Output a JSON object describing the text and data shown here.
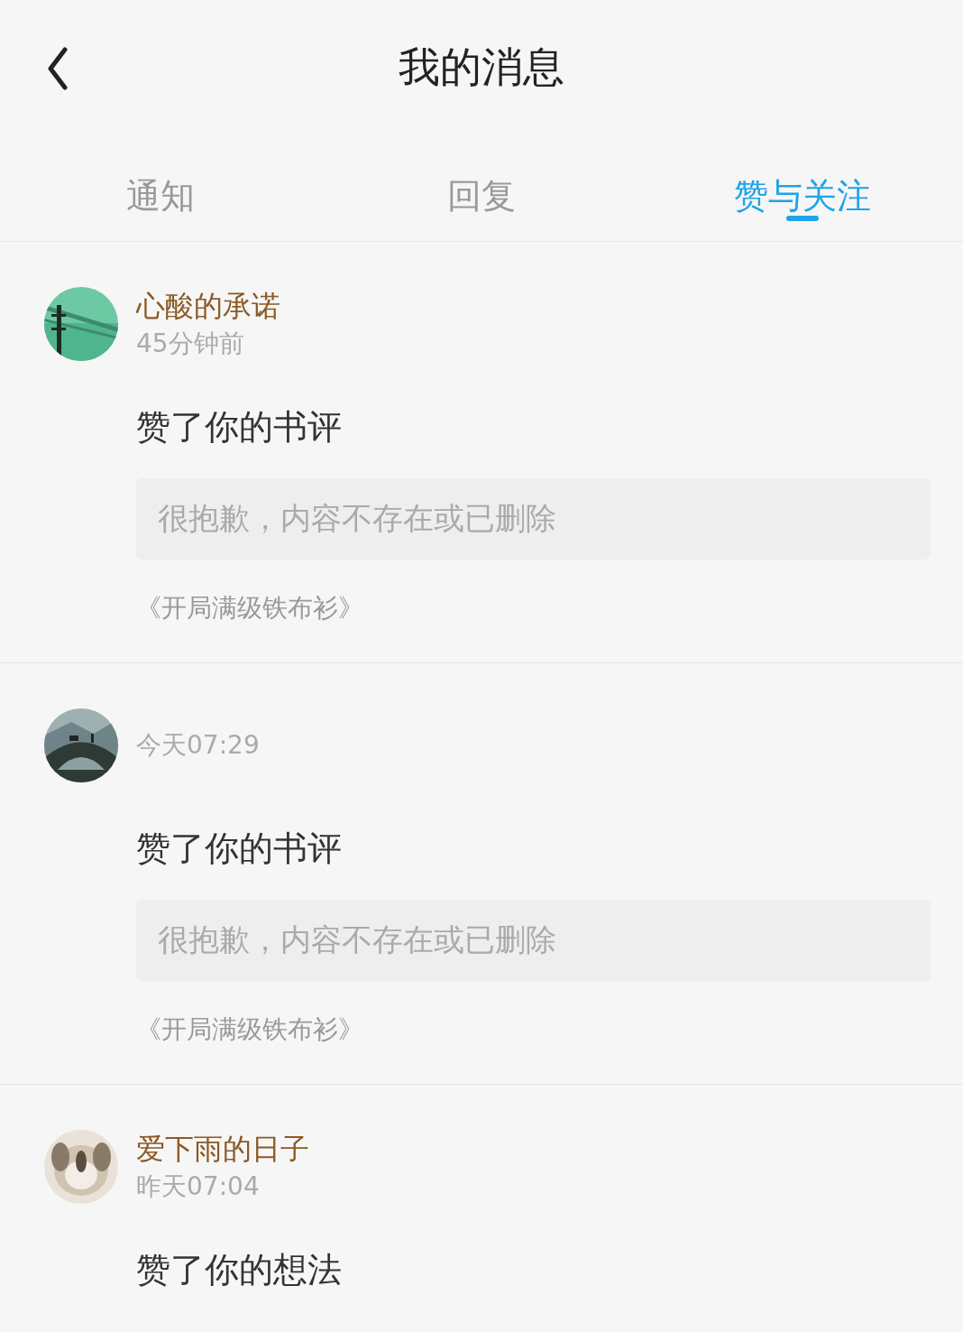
{
  "header": {
    "title": "我的消息"
  },
  "tabs": [
    {
      "label": "通知",
      "selected": false
    },
    {
      "label": "回复",
      "selected": false
    },
    {
      "label": "赞与关注",
      "selected": true
    }
  ],
  "messages": [
    {
      "name": "心酸的承诺",
      "time": "45分钟前",
      "action": "赞了你的书评",
      "quote": "很抱歉，内容不存在或已删除",
      "book": "《开局满级铁布衫》"
    },
    {
      "time": "今天07:29",
      "action": "赞了你的书评",
      "quote": "很抱歉，内容不存在或已删除",
      "book": "《开局满级铁布衫》"
    },
    {
      "name": "爱下雨的日子",
      "time": "昨天07:04",
      "action": "赞了你的想法"
    }
  ]
}
